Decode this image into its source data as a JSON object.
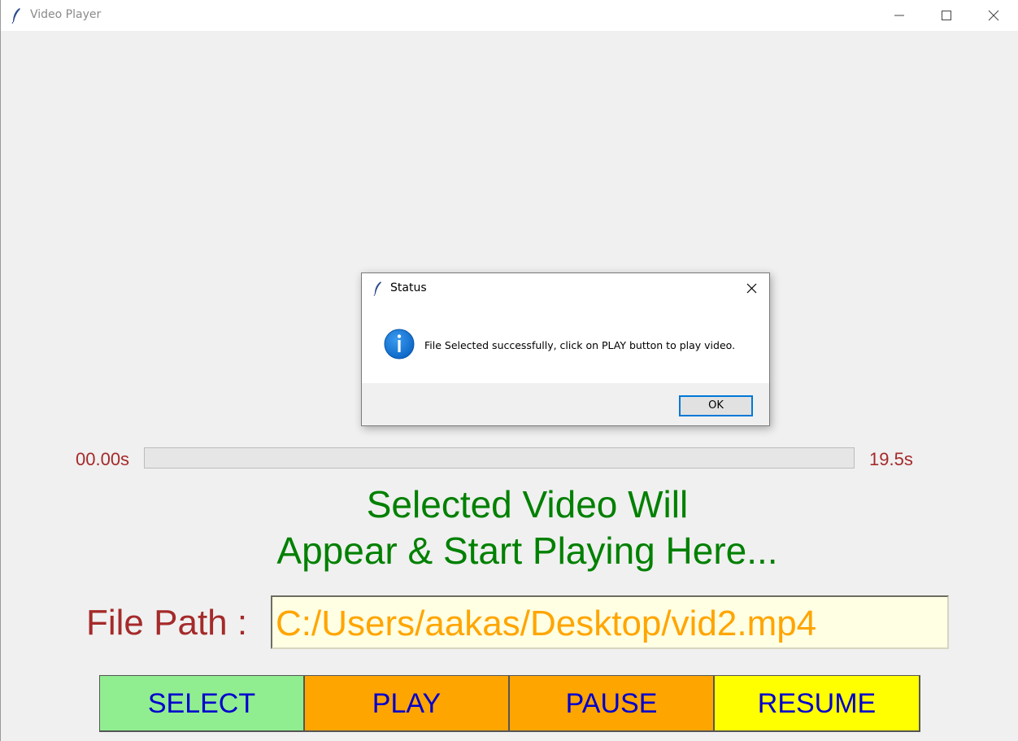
{
  "window": {
    "title": "Video Player",
    "controls": {
      "minimize": "minimize-icon",
      "maximize": "maximize-icon",
      "close": "close-icon"
    }
  },
  "player": {
    "time_start": "00.00s",
    "time_end": "19.5s",
    "progress_fraction": 0,
    "placeholder_line1": "Selected Video Will",
    "placeholder_line2": "Appear & Start Playing Here..."
  },
  "file_path": {
    "label": "File Path :",
    "value": "C:/Users/aakas/Desktop/vid2.mp4"
  },
  "buttons": {
    "select": "SELECT",
    "play": "PLAY",
    "pause": "PAUSE",
    "resume": "RESUME"
  },
  "dialog": {
    "title": "Status",
    "icon": "info-icon",
    "message": "File Selected successfully, click on PLAY button to play video.",
    "ok_label": "OK"
  },
  "colors": {
    "time_text": "#a52a2a",
    "placeholder_text": "#008000",
    "path_label": "#a52a2a",
    "path_value": "#ffa500",
    "path_background": "#ffffe4",
    "button_text": "#0000cd",
    "select_bg": "#90ee90",
    "play_bg": "#ffa500",
    "pause_bg": "#ffa500",
    "resume_bg": "#ffff00",
    "dialog_accent": "#0078d7"
  }
}
